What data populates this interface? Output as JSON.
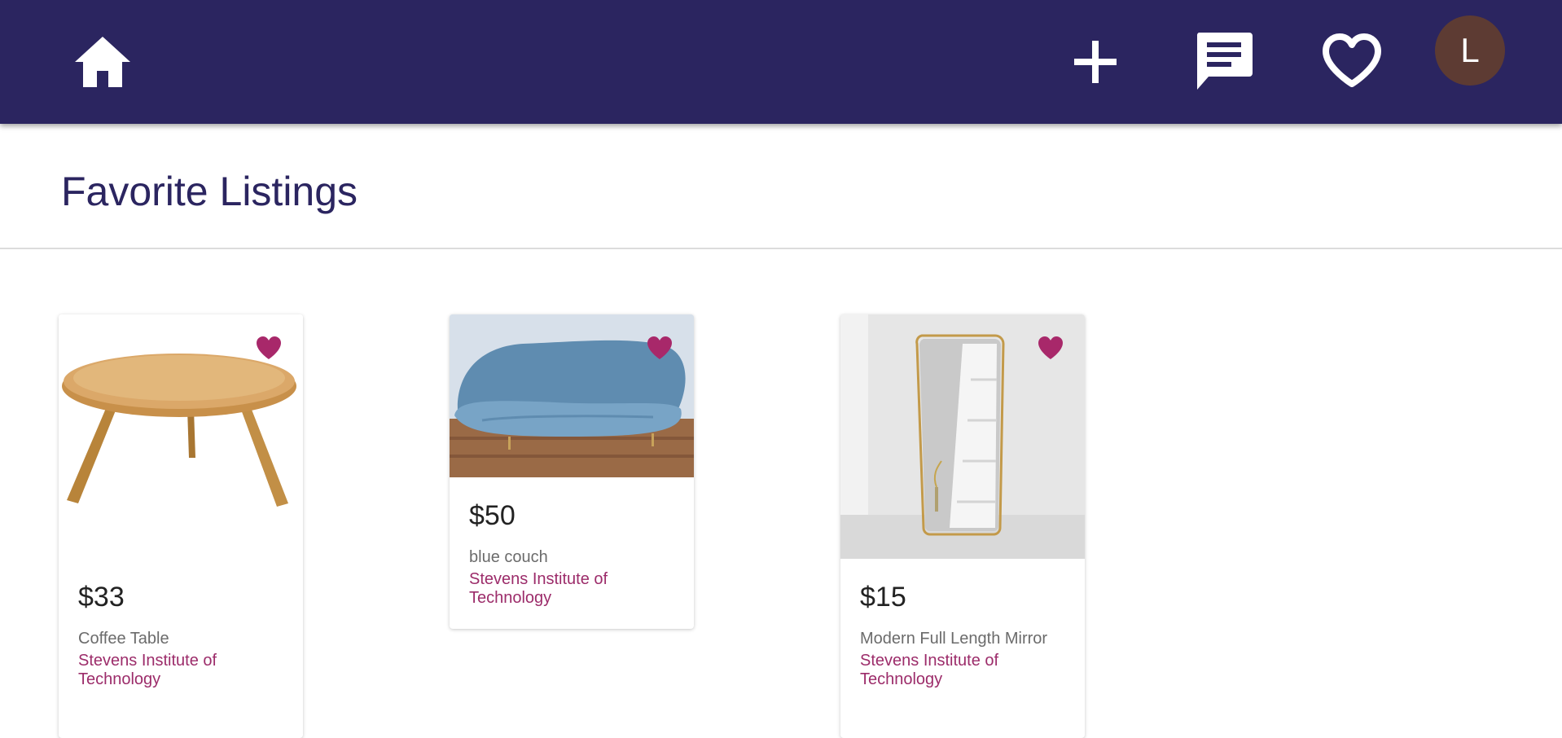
{
  "nav": {
    "home_icon": "home-icon",
    "add_icon": "plus-icon",
    "messages_icon": "chat-icon",
    "favorites_icon": "heart-outline-icon",
    "avatar_initial": "L",
    "avatar_color": "#5d3b33",
    "bar_color": "#2b2560"
  },
  "page": {
    "title": "Favorite Listings"
  },
  "listings": [
    {
      "price": "$33",
      "name": "Coffee Table",
      "school": "Stevens Institute of Technology",
      "favorited": true,
      "image": "coffee-table-image"
    },
    {
      "price": "$50",
      "name": "blue couch",
      "school": "Stevens Institute of Technology",
      "favorited": true,
      "image": "blue-couch-image"
    },
    {
      "price": "$15",
      "name": "Modern Full Length Mirror",
      "school": "Stevens Institute of Technology",
      "favorited": true,
      "image": "mirror-image"
    }
  ],
  "colors": {
    "accent": "#9c2c6a",
    "heart": "#a8286a"
  }
}
